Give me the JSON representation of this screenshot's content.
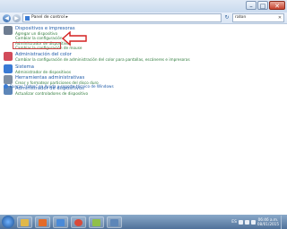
{
  "window": {
    "toolbar": {
      "address_text": "Panel de control ▸",
      "search_value": "raton"
    }
  },
  "categories": [
    {
      "title": "Dispositivos e impresoras",
      "links": [
        "Agregar un dispositivo",
        "Cambiar la configuración del mouse",
        "Administrador de dispositivos",
        "Cambiar la configuración de mouse"
      ],
      "icon_color": "#6d7c90"
    },
    {
      "title": "Administración del color",
      "links": [
        "Cambiar la configuración de administración del color para pantallas, escáneres e impresoras"
      ],
      "icon_color": "#d24b5a"
    },
    {
      "title": "Sistema",
      "links": [
        "Administrador de dispositivos"
      ],
      "icon_color": "#3a7bd5"
    },
    {
      "title": "Herramientas administrativas",
      "links": [
        "Crear y formatear particiones del disco duro"
      ],
      "icon_color": "#7f8fa3"
    },
    {
      "title": "Administrador de dispositivos",
      "links": [
        "Actualizar controladores de dispositivo"
      ],
      "icon_color": "#5d86b8"
    }
  ],
  "help": {
    "text": "Buscar \"raton\" en Ayuda y soporte técnico de Windows"
  },
  "taskbar": {
    "apps": [
      {
        "name": "explorer",
        "color": "#e0b84a"
      },
      {
        "name": "media-player",
        "color": "#e36b2a"
      },
      {
        "name": "browser",
        "color": "#4a8ad8"
      },
      {
        "name": "chrome",
        "color": "#d94a3a"
      },
      {
        "name": "paint",
        "color": "#8fbf4a"
      },
      {
        "name": "control-panel",
        "color": "#5d86b8"
      }
    ],
    "lang": "ES",
    "time": "06:46 a.m.",
    "date": "08/01/2015"
  }
}
